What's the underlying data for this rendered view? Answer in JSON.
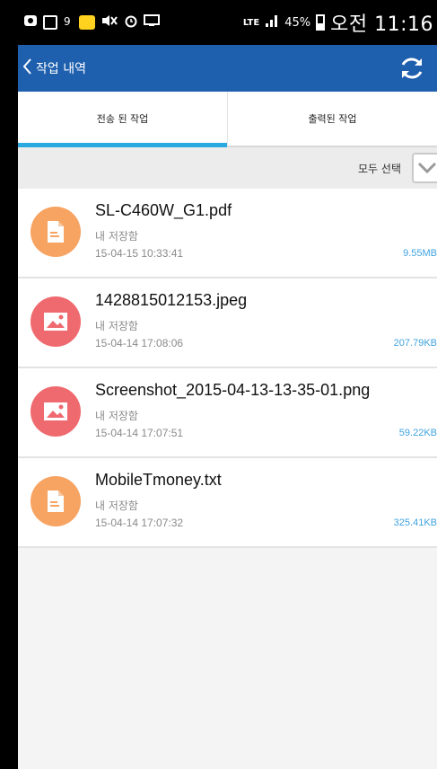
{
  "colors": {
    "appbar": "#1e5fae",
    "tab_indicator": "#2aa9e0",
    "doc_icon": "#f7a362",
    "image_icon": "#ef6a6f",
    "file_size": "#3fa3e0"
  },
  "status_bar": {
    "battery": "45%",
    "network": "LTE",
    "time": "오전 11:16"
  },
  "app_bar": {
    "title": "작업 내역",
    "back_icon": "chevron-left-icon",
    "refresh_icon": "refresh-icon"
  },
  "tabs": [
    {
      "label": "전송 된 작업",
      "active": true
    },
    {
      "label": "출력된 작업",
      "active": false
    }
  ],
  "select_all": {
    "label": "모두 선택",
    "icon": "chevron-down-icon"
  },
  "files": [
    {
      "name": "SL-C460W_G1.pdf",
      "location": "내 저장함",
      "date": "15-04-15 10:33:41",
      "size": "9.55MB",
      "type": "document"
    },
    {
      "name": "1428815012153.jpeg",
      "location": "내 저장함",
      "date": "15-04-14 17:08:06",
      "size": "207.79KB",
      "type": "image"
    },
    {
      "name": "Screenshot_2015-04-13-13-35-01.png",
      "location": "내 저장함",
      "date": "15-04-14 17:07:51",
      "size": "59.22KB",
      "type": "image"
    },
    {
      "name": "MobileTmoney.txt",
      "location": "내 저장함",
      "date": "15-04-14 17:07:32",
      "size": "325.41KB",
      "type": "document"
    }
  ]
}
